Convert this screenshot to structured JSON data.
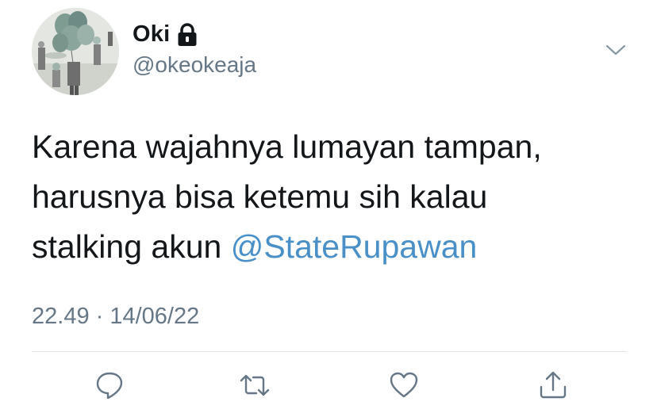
{
  "author": {
    "display_name": "Oki",
    "handle": "@okeokeaja",
    "protected_icon": "lock-icon",
    "avatar": "avatar-image"
  },
  "menu_icon": "chevron-down-icon",
  "tweet": {
    "line1": "Karena wajahnya lumayan tampan,",
    "line2": "harusnya bisa ketemu sih kalau",
    "line3_prefix": "stalking akun ",
    "mention": "@StateRupawan",
    "timestamp": "22.49 · 14/06/22"
  },
  "actions": [
    {
      "icon": "reply-icon"
    },
    {
      "icon": "retweet-icon"
    },
    {
      "icon": "like-icon"
    },
    {
      "icon": "share-icon"
    }
  ],
  "colors": {
    "text": "#14171a",
    "secondary": "#657786",
    "mention": "#4a90c8",
    "divider": "#e1e4e8"
  }
}
